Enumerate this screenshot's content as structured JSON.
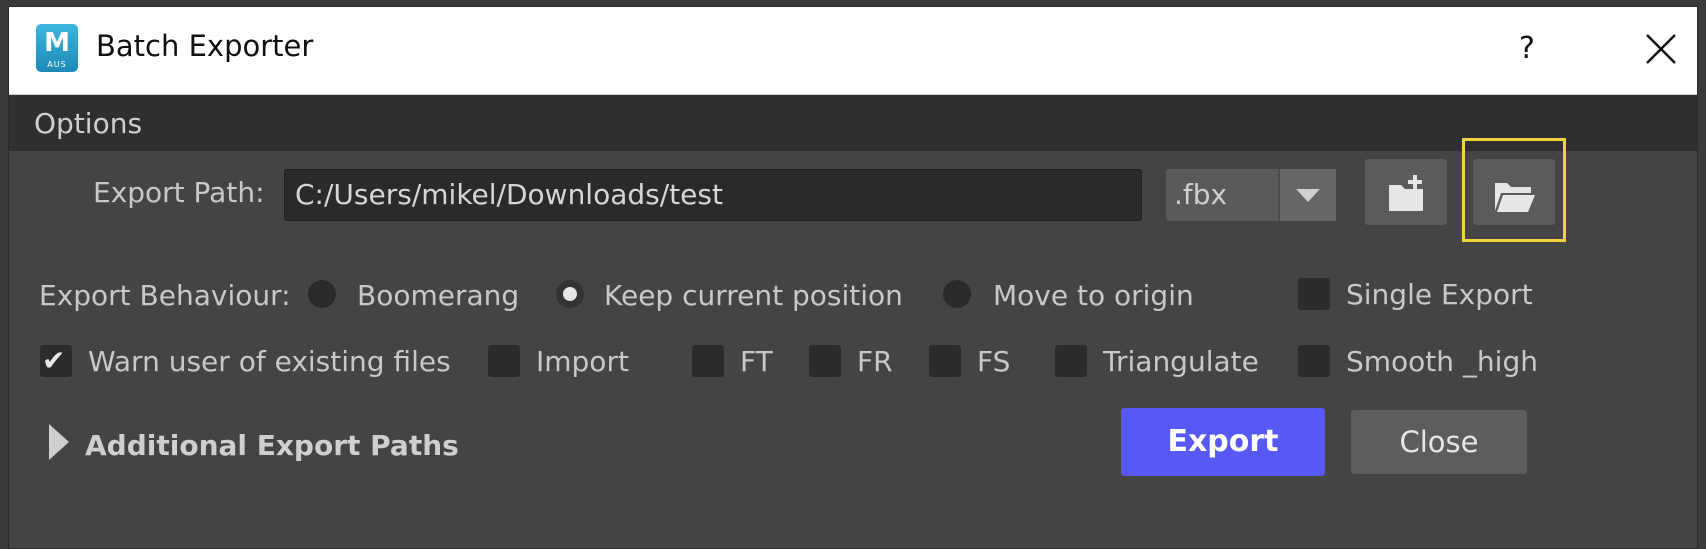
{
  "window": {
    "title": "Batch Exporter",
    "app_icon": {
      "letter": "M",
      "sub": "AUS"
    },
    "help_label": "?"
  },
  "menu": {
    "options_label": "Options"
  },
  "export_path": {
    "label": "Export Path:",
    "value": "C:/Users/mikel/Downloads/test",
    "format_selected": ".fbx",
    "new_folder_icon": "new-folder-icon",
    "browse_icon": "open-folder-icon"
  },
  "behaviour": {
    "label": "Export Behaviour:",
    "options": [
      {
        "label": "Boomerang",
        "selected": false
      },
      {
        "label": "Keep current position",
        "selected": true
      },
      {
        "label": "Move to origin",
        "selected": false
      }
    ],
    "single_export": {
      "label": "Single Export",
      "checked": false
    }
  },
  "flags": {
    "warn_existing": {
      "label": "Warn user of existing files",
      "checked": true
    },
    "import": {
      "label": "Import",
      "checked": false
    },
    "ft": {
      "label": "FT",
      "checked": false
    },
    "fr": {
      "label": "FR",
      "checked": false
    },
    "fs": {
      "label": "FS",
      "checked": false
    },
    "triangulate": {
      "label": "Triangulate",
      "checked": false
    },
    "smooth_high": {
      "label": "Smooth _high",
      "checked": false
    }
  },
  "additional_paths": {
    "label": "Additional Export Paths",
    "expanded": false
  },
  "buttons": {
    "export_label": "Export",
    "close_label": "Close"
  },
  "colors": {
    "accent": "#5858f5",
    "highlight": "#f2d23c",
    "panel": "#444444"
  }
}
